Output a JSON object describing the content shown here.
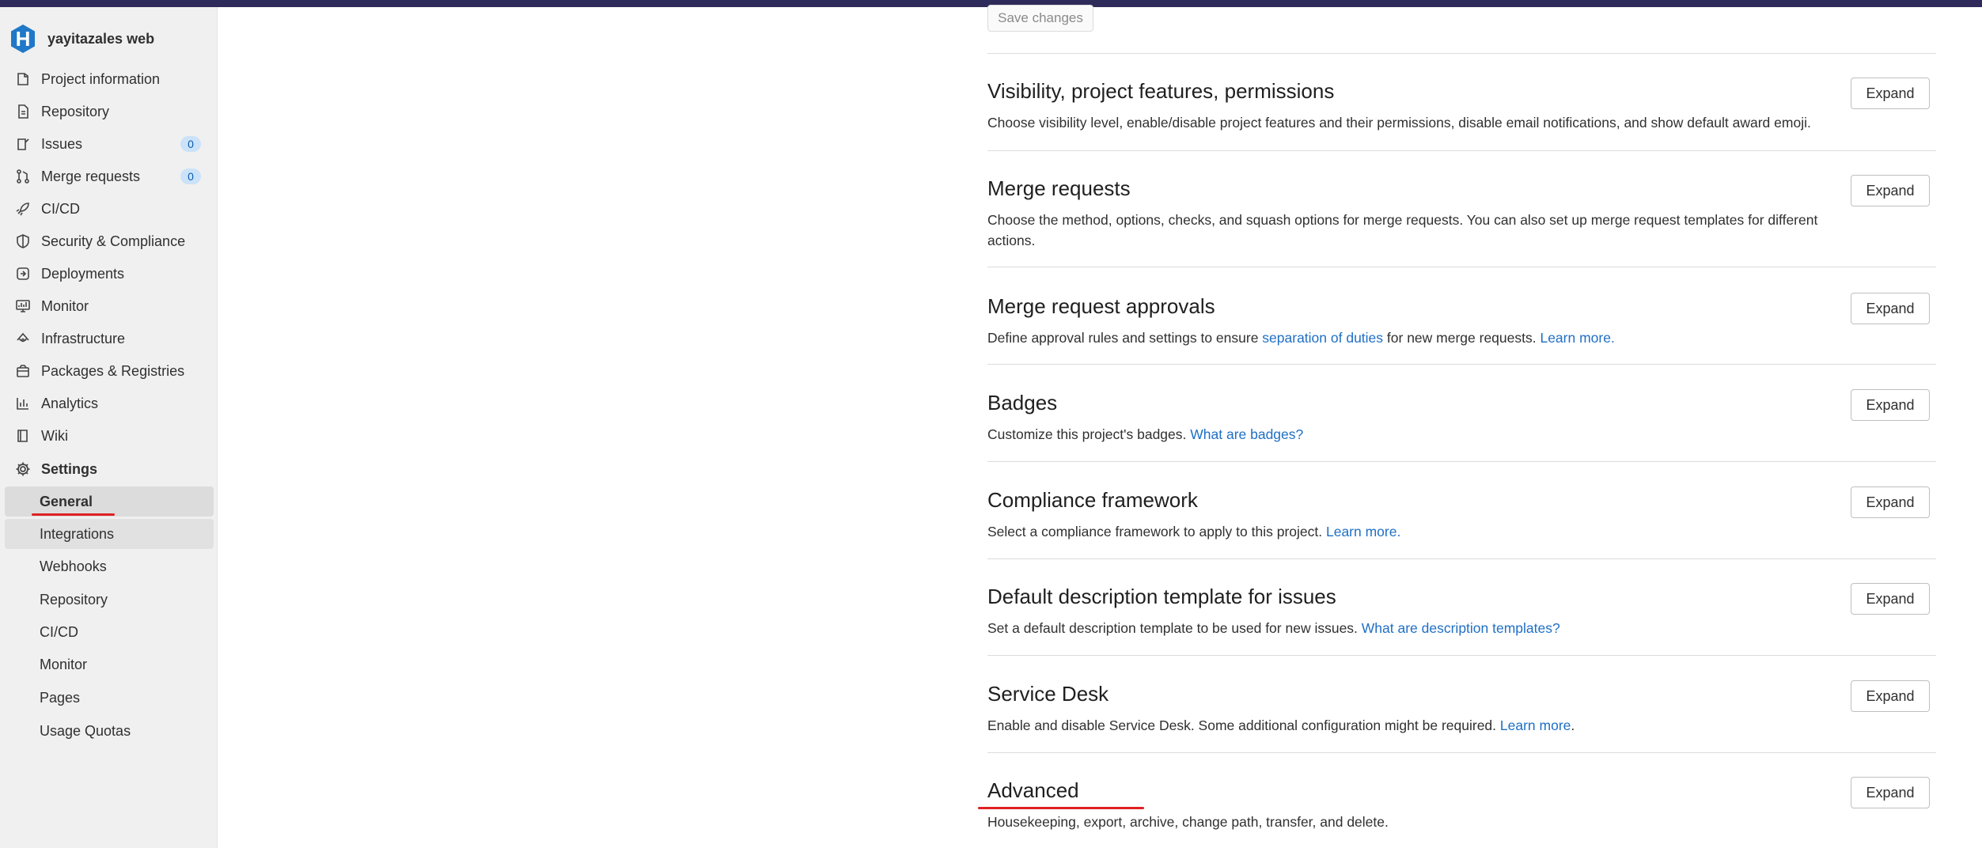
{
  "project": {
    "initial": "H",
    "name": "yayitazales web"
  },
  "nav": [
    {
      "label": "Project information",
      "icon": "project-icon"
    },
    {
      "label": "Repository",
      "icon": "doc-icon"
    },
    {
      "label": "Issues",
      "icon": "issues-icon",
      "count": "0"
    },
    {
      "label": "Merge requests",
      "icon": "merge-request-icon",
      "count": "0"
    },
    {
      "label": "CI/CD",
      "icon": "rocket-icon"
    },
    {
      "label": "Security & Compliance",
      "icon": "shield-icon"
    },
    {
      "label": "Deployments",
      "icon": "deployments-icon"
    },
    {
      "label": "Monitor",
      "icon": "monitor-icon"
    },
    {
      "label": "Infrastructure",
      "icon": "cloud-icon"
    },
    {
      "label": "Packages & Registries",
      "icon": "package-icon"
    },
    {
      "label": "Analytics",
      "icon": "chart-icon"
    },
    {
      "label": "Wiki",
      "icon": "book-icon"
    },
    {
      "label": "Settings",
      "icon": "gear-icon"
    }
  ],
  "settings_sub": [
    {
      "label": "General"
    },
    {
      "label": "Integrations"
    },
    {
      "label": "Webhooks"
    },
    {
      "label": "Repository"
    },
    {
      "label": "CI/CD"
    },
    {
      "label": "Monitor"
    },
    {
      "label": "Pages"
    },
    {
      "label": "Usage Quotas"
    }
  ],
  "main": {
    "save_label": "Save changes",
    "expand_label": "Expand",
    "sections": [
      {
        "title": "Visibility, project features, permissions",
        "desc": "Choose visibility level, enable/disable project features and their permissions, disable email notifications, and show default award emoji."
      },
      {
        "title": "Merge requests",
        "desc": "Choose the method, options, checks, and squash options for merge requests. You can also set up merge request templates for different actions."
      },
      {
        "title": "Merge request approvals",
        "desc_pre": "Define approval rules and settings to ensure ",
        "link1": "separation of duties",
        "desc_mid": " for new merge requests. ",
        "link2": "Learn more."
      },
      {
        "title": "Badges",
        "desc_pre": "Customize this project's badges. ",
        "link1": "What are badges?"
      },
      {
        "title": "Compliance framework",
        "desc_pre": "Select a compliance framework to apply to this project. ",
        "link1": "Learn more."
      },
      {
        "title": "Default description template for issues",
        "desc_pre": "Set a default description template to be used for new issues. ",
        "link1": "What are description templates?"
      },
      {
        "title": "Service Desk",
        "desc_pre": "Enable and disable Service Desk. Some additional configuration might be required. ",
        "link1": "Learn more",
        "desc_post": "."
      },
      {
        "title": "Advanced",
        "desc": "Housekeeping, export, archive, change path, transfer, and delete."
      }
    ]
  }
}
